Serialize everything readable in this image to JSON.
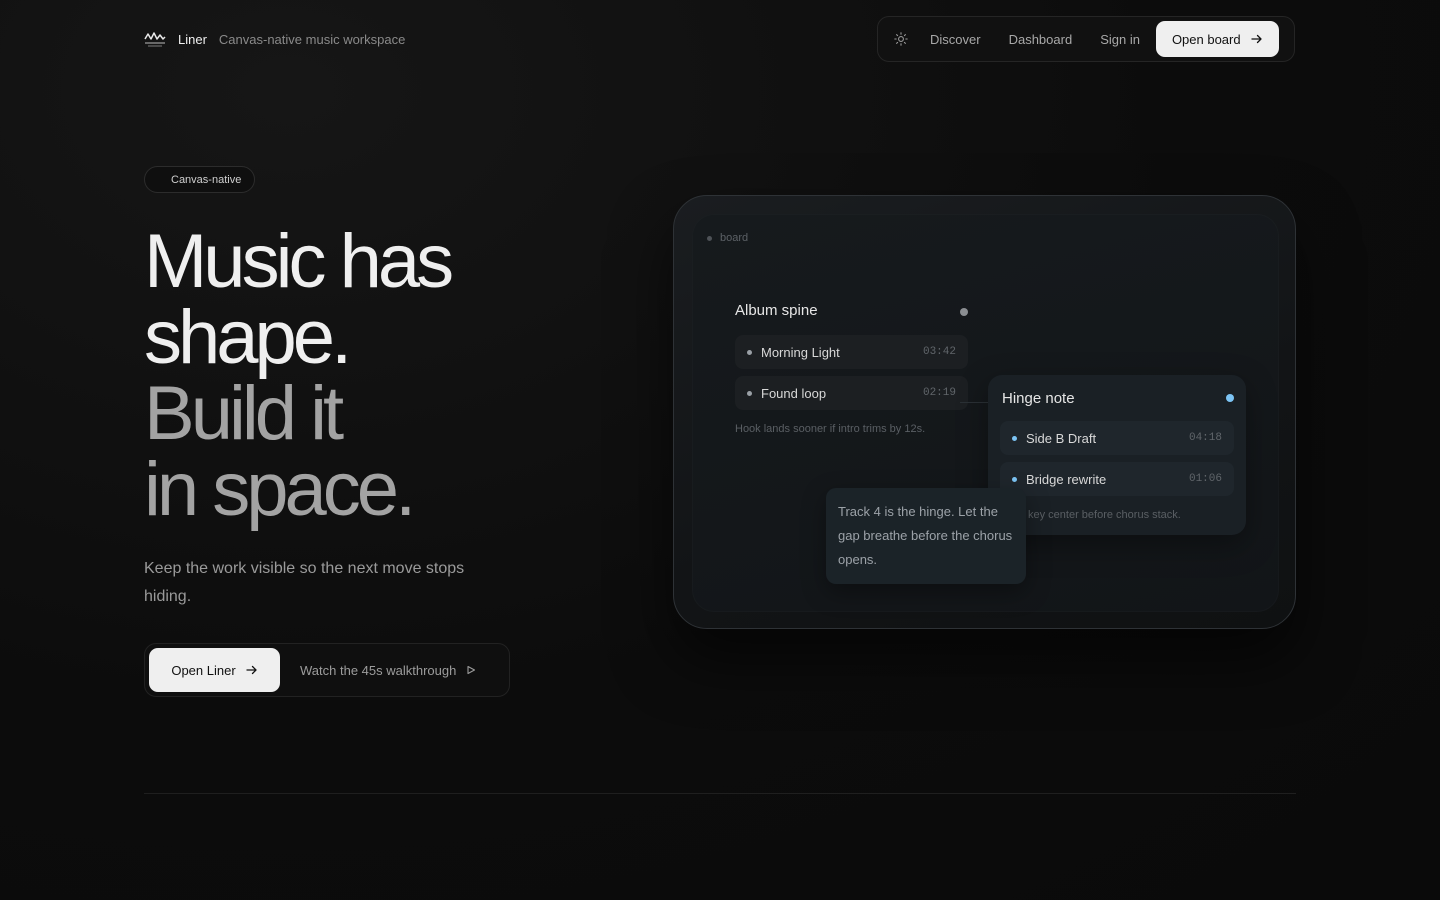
{
  "brand": {
    "name": "Liner",
    "tagline": "Canvas-native music workspace"
  },
  "nav": {
    "links": [
      "Discover",
      "Dashboard",
      "Sign in"
    ],
    "cta": "Open board"
  },
  "hero": {
    "pill": "Canvas-native",
    "headline": [
      "Music has",
      "shape.",
      "Build it",
      "in space."
    ],
    "lede": "Keep the work visible so the next move stops hiding.",
    "primary_cta": "Open Liner",
    "secondary_cta": "Watch the 45s walkthrough"
  },
  "board": {
    "label": "board",
    "album_card": {
      "title": "Album spine",
      "tracks": [
        {
          "name": "Morning Light",
          "time": "03:42"
        },
        {
          "name": "Found loop",
          "time": "02:19"
        }
      ],
      "note": "Hook lands sooner if intro trims by 12s."
    },
    "hinge_card": {
      "title": "Hinge note",
      "tracks": [
        {
          "name": "Side B Draft",
          "time": "04:18"
        },
        {
          "name": "Bridge rewrite",
          "time": "01:06"
        }
      ],
      "note": "key center before chorus stack."
    },
    "sticky_note": "Track 4 is the hinge. Let the gap breathe before the chorus opens."
  },
  "colors": {
    "accent": "#7cc4f4",
    "cta_bg": "#efefef",
    "background": "#0c0c0c"
  }
}
